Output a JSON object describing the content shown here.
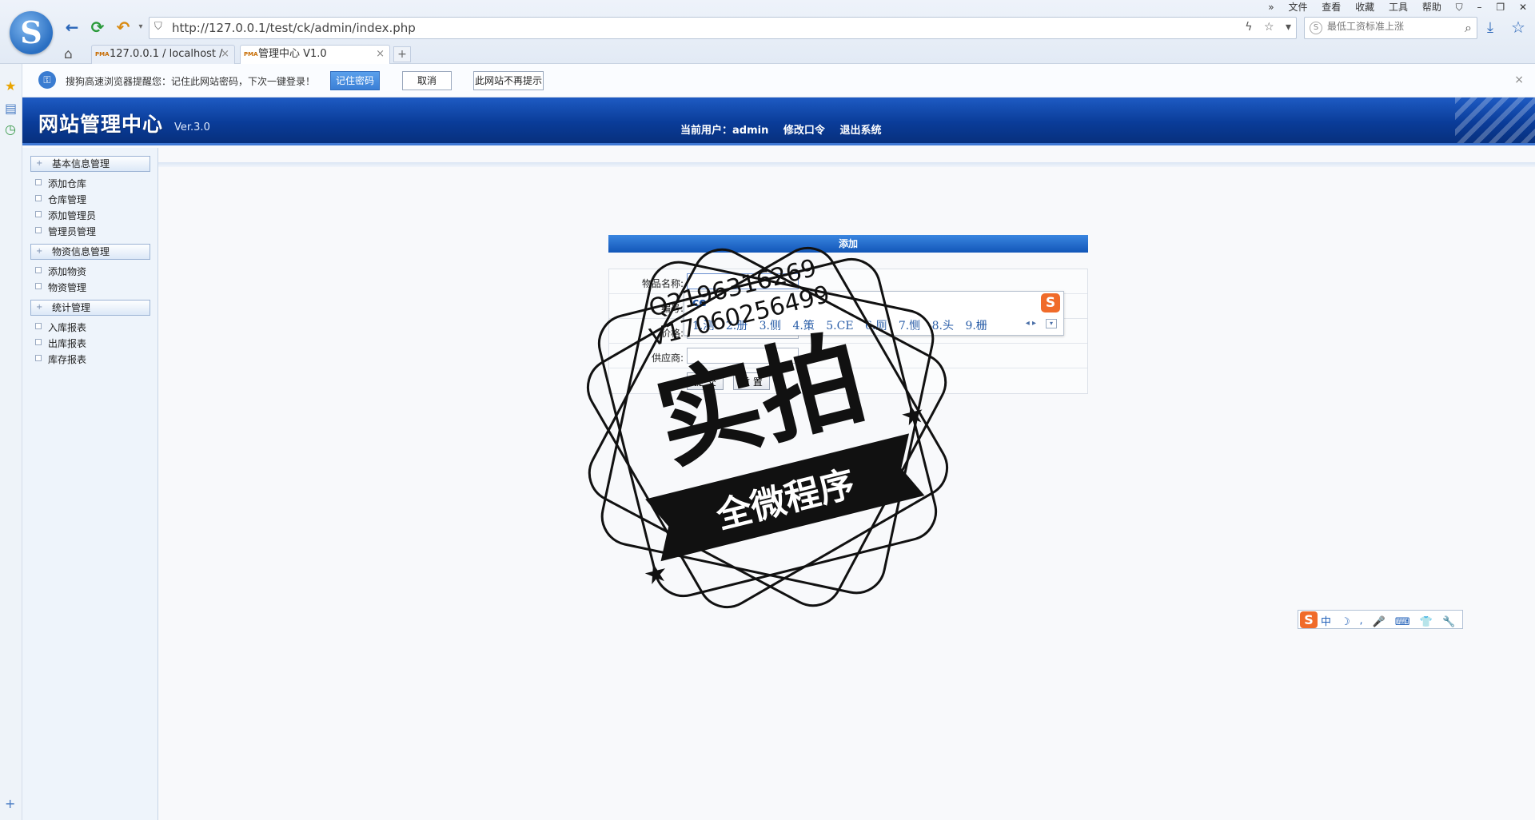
{
  "browser": {
    "logo": "S",
    "url": "http://127.0.0.1/test/ck/admin/index.php",
    "search_placeholder": "最低工资标准上涨",
    "menu": [
      "文件",
      "查看",
      "收藏",
      "工具",
      "帮助"
    ],
    "menu_prefix": "»",
    "tabs": [
      {
        "label": "127.0.0.1 / localhost /",
        "favicon": "PMA",
        "active": false
      },
      {
        "label": "管理中心 V1.0",
        "favicon": "PMA",
        "active": true
      }
    ],
    "new_tab": "+",
    "close": "×"
  },
  "notification": {
    "text": "搜狗高速浏览器提醒您：记住此网站密码，下次一键登录！",
    "remember": "记住密码",
    "cancel": "取消",
    "never": "此网站不再提示",
    "close": "×"
  },
  "header": {
    "title": "网站管理中心",
    "version": "Ver.3.0",
    "current_user_label": "当前用户：",
    "current_user": "admin",
    "change_password": "修改口令",
    "logout": "退出系统"
  },
  "sidebar": {
    "sections": [
      {
        "label": "基本信息管理",
        "items": [
          "添加仓库",
          "仓库管理",
          "添加管理员",
          "管理员管理"
        ]
      },
      {
        "label": "物资信息管理",
        "items": [
          "添加物资",
          "物资管理"
        ]
      },
      {
        "label": "统计管理",
        "items": [
          "入库报表",
          "出库报表",
          "库存报表"
        ]
      }
    ]
  },
  "form": {
    "title": "添加",
    "fields": [
      {
        "label": "物品名称:",
        "value": ""
      },
      {
        "label": "编号:",
        "value": ""
      },
      {
        "label": "价格:",
        "value": ""
      },
      {
        "label": "供应商:",
        "value": ""
      }
    ],
    "submit": "提 交",
    "reset": "重 置"
  },
  "ime": {
    "input": "ce",
    "candidates": [
      "1.测",
      "2.册",
      "3.侧",
      "4.策",
      "5.CE",
      "6.厕",
      "7.恻",
      "8.头",
      "9.栅"
    ],
    "logo": "S",
    "status_tools": [
      "中",
      "☽",
      "⸴",
      "🎤",
      "⌨",
      "👕",
      "🔧"
    ]
  },
  "watermark": {
    "main": "实拍",
    "ribbon": "全微程序",
    "line1": "Q2196316269",
    "line2": "V17060256499"
  },
  "colors": {
    "banner": "#0a3c99",
    "form_header": "#1a62c4",
    "ime_brand": "#f06b2a"
  }
}
